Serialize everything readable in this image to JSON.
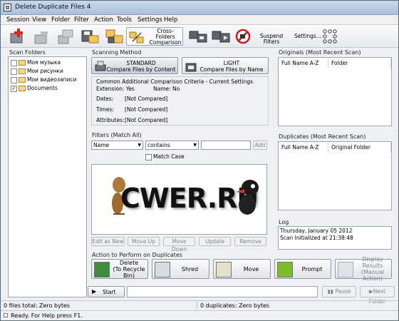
{
  "window": {
    "title": "Delete Duplicate Files 4"
  },
  "menu": [
    "Session",
    "View",
    "Folder",
    "Filter",
    "Action",
    "Tools",
    "Settings",
    "Help"
  ],
  "toolbar": {
    "cross_folders": "Cross-\nFolders\nComparison",
    "suspend_filters": "Suspend Filters",
    "settings": "Settings..."
  },
  "scan_folders": {
    "title": "Scan Folders",
    "items": [
      {
        "label": "Моя музыка",
        "checked": false
      },
      {
        "label": "Мои рисунки",
        "checked": false
      },
      {
        "label": "Мои видеозаписи",
        "checked": false
      },
      {
        "label": "Documents",
        "checked": true
      }
    ]
  },
  "scanning": {
    "title": "Scanning Method",
    "standard_title": "STANDARD",
    "standard_sub": "Compare Files by Content",
    "light_title": "LIGHT",
    "light_sub": "Compare Files by Name",
    "criteria_title": "Common Additional Comparison Criteria - Current Settings",
    "extension": "Extension: Yes",
    "name": "Name: No",
    "dates": "Dates:",
    "dates_val": "[Not Compared]",
    "times": "Times:",
    "times_val": "[Not Compared]",
    "attributes": "Attributes:",
    "attributes_val": "[Not Compared]"
  },
  "filters": {
    "title": "Filters (Match All)",
    "field": "Name",
    "op": "contains",
    "value": "",
    "add": "Add",
    "match_case": "Match Case",
    "watermark": "CWER.RU",
    "buttons": [
      "Edit as New",
      "Move Up",
      "Move Down",
      "Update",
      "Remove"
    ]
  },
  "originals": {
    "title": "Originals (Most Recent Scan)",
    "col1": "Full Name A-Z",
    "col2": "Folder"
  },
  "duplicates": {
    "title": "Duplicates (Most Recent Scan)",
    "col1": "Full Name A-Z",
    "col2": "Original Folder"
  },
  "log": {
    "title": "Log",
    "line1": "Thursday, January 05 2012",
    "line2": "Scan Initialized at 21:38:48"
  },
  "actions": {
    "title": "Action to Perform on Duplicates",
    "delete": "Delete\n(To Recycle Bin)",
    "shred": "Shred",
    "move": "Move",
    "prompt": "Prompt",
    "display": "Display Results\n(Manual Action)"
  },
  "controls": {
    "start": "Start",
    "pause": "Pause",
    "next_folder": "Next Folder"
  },
  "status": {
    "files": "0 files total: Zero bytes",
    "duplicates": "0 duplicates: Zero bytes",
    "ready": "Ready. For Help press F1."
  }
}
